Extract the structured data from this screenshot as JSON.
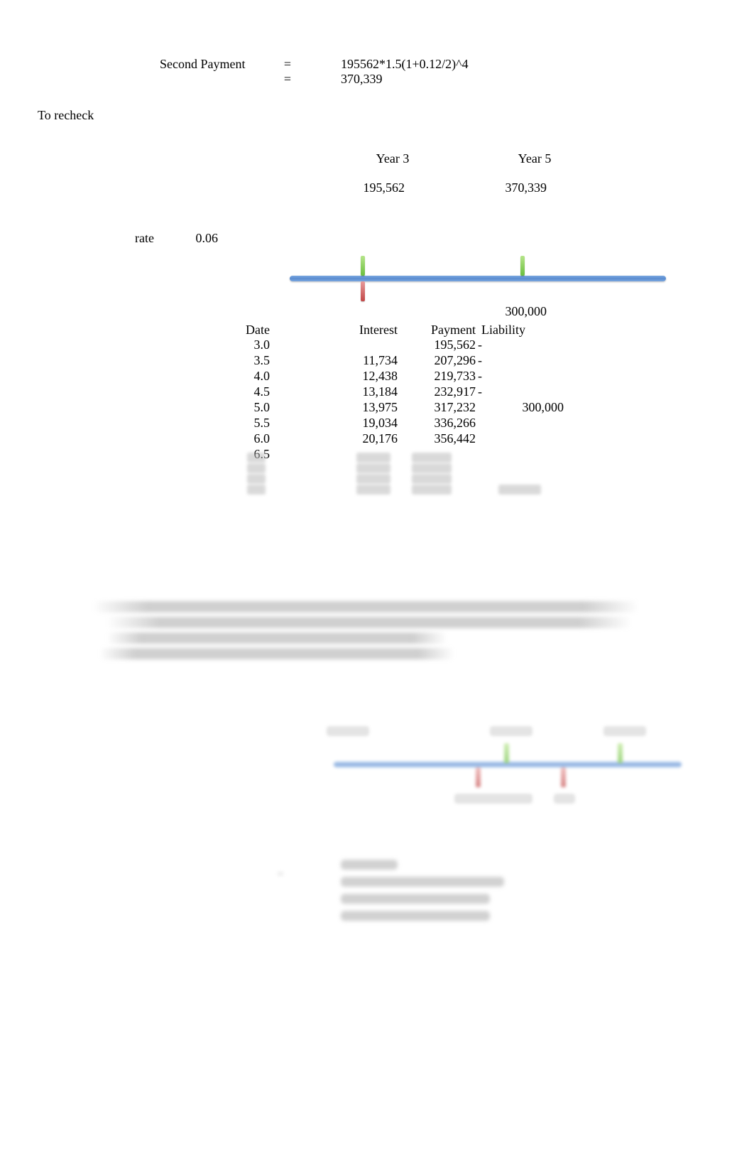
{
  "header": {
    "label": "Second Payment",
    "eq": "=",
    "formula": "195562*1.5(1+0.12/2)^4",
    "eq2": "=",
    "result": "370,339"
  },
  "to_recheck_label": "To recheck",
  "years": {
    "y3": "Year 3",
    "y5": "Year 5"
  },
  "amounts": {
    "a1": "195,562",
    "a2": "370,339"
  },
  "rate": {
    "label": "rate",
    "value": "0.06"
  },
  "below_timeline_value": "300,000",
  "table": {
    "headers": {
      "date": "Date",
      "interest": "Interest",
      "payment": "Payment",
      "liability": "Liability"
    },
    "rows": [
      {
        "date": "3.0",
        "interest": "",
        "payment": "195,562",
        "dash": "-",
        "liability": ""
      },
      {
        "date": "3.5",
        "interest": "11,734",
        "payment": "207,296",
        "dash": "-",
        "liability": ""
      },
      {
        "date": "4.0",
        "interest": "12,438",
        "payment": "219,733",
        "dash": "-",
        "liability": ""
      },
      {
        "date": "4.5",
        "interest": "13,184",
        "payment": "232,917",
        "dash": "-",
        "liability": ""
      },
      {
        "date": "5.0",
        "interest": "13,975",
        "payment": "317,232",
        "dash": "",
        "liability": "300,000"
      },
      {
        "date": "5.5",
        "interest": "19,034",
        "payment": "336,266",
        "dash": "",
        "liability": ""
      },
      {
        "date": "6.0",
        "interest": "20,176",
        "payment": "356,442",
        "dash": "",
        "liability": ""
      },
      {
        "date": "6.5",
        "interest": "",
        "payment": "",
        "dash": "",
        "liability": ""
      }
    ]
  }
}
